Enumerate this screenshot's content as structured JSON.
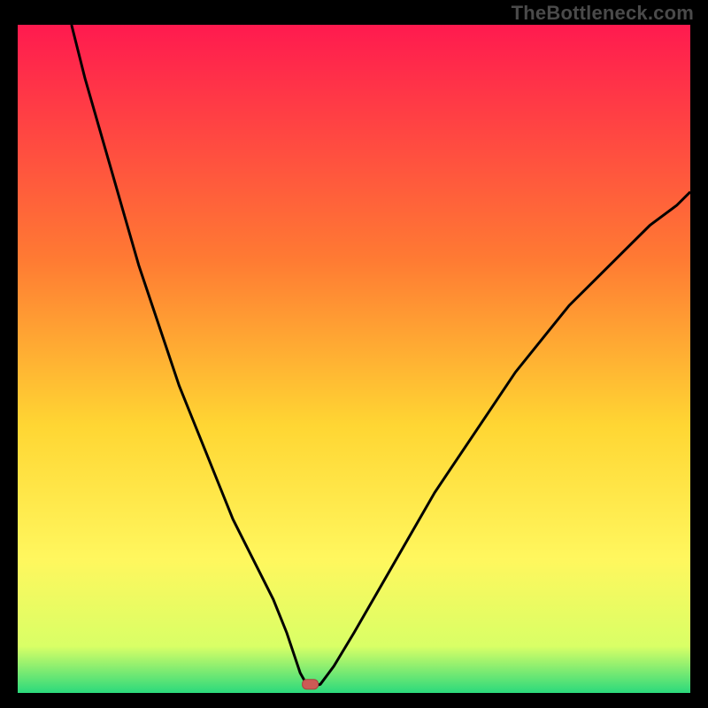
{
  "watermark": "TheBottleneck.com",
  "colors": {
    "frame": "#000000",
    "curve": "#000000",
    "marker_fill": "#cc5a55",
    "marker_stroke": "#a8443f",
    "grad_top": "#ff1a4f",
    "grad_mid1": "#ff7a33",
    "grad_mid2": "#ffd633",
    "grad_mid3": "#fff75e",
    "grad_mid4": "#d9ff66",
    "grad_bottom": "#2bd97c"
  },
  "chart_data": {
    "type": "line",
    "title": "",
    "xlabel": "",
    "ylabel": "",
    "xlim": [
      0,
      100
    ],
    "ylim": [
      0,
      100
    ],
    "min_x": 42,
    "min_y": 1,
    "marker": {
      "x": 43.5,
      "y": 1.3
    },
    "series": [
      {
        "name": "curve",
        "x": [
          8,
          10,
          12,
          14,
          16,
          18,
          20,
          22,
          24,
          26,
          28,
          30,
          32,
          34,
          36,
          38,
          40,
          41,
          42,
          43,
          44,
          45,
          47,
          50,
          54,
          58,
          62,
          66,
          70,
          74,
          78,
          82,
          86,
          90,
          94,
          98,
          100
        ],
        "y": [
          100,
          92,
          85,
          78,
          71,
          64,
          58,
          52,
          46,
          41,
          36,
          31,
          26,
          22,
          18,
          14,
          9,
          6,
          3,
          1.2,
          1,
          1.3,
          4,
          9,
          16,
          23,
          30,
          36,
          42,
          48,
          53,
          58,
          62,
          66,
          70,
          73,
          75
        ]
      }
    ]
  }
}
